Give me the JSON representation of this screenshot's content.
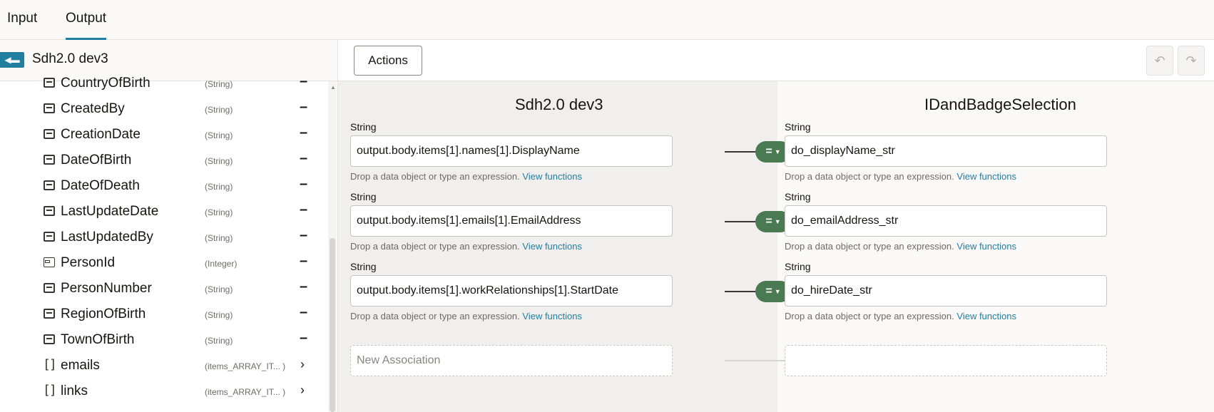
{
  "tabs": [
    {
      "label": "Input"
    },
    {
      "label": "Output"
    }
  ],
  "left_panel": {
    "back_icon": "back-arrow-icon",
    "title": "Sdh2.0 dev3",
    "fields": [
      {
        "name": "CountryOfBirth",
        "type": "(String)",
        "action": "–",
        "icon": "string-field-icon"
      },
      {
        "name": "CreatedBy",
        "type": "(String)",
        "action": "–",
        "icon": "string-field-icon"
      },
      {
        "name": "CreationDate",
        "type": "(String)",
        "action": "–",
        "icon": "string-field-icon"
      },
      {
        "name": "DateOfBirth",
        "type": "(String)",
        "action": "–",
        "icon": "string-field-icon"
      },
      {
        "name": "DateOfDeath",
        "type": "(String)",
        "action": "–",
        "icon": "string-field-icon"
      },
      {
        "name": "LastUpdateDate",
        "type": "(String)",
        "action": "–",
        "icon": "string-field-icon"
      },
      {
        "name": "LastUpdatedBy",
        "type": "(String)",
        "action": "–",
        "icon": "string-field-icon"
      },
      {
        "name": "PersonId",
        "type": "(Integer)",
        "action": "–",
        "icon": "integer-field-icon"
      },
      {
        "name": "PersonNumber",
        "type": "(String)",
        "action": "–",
        "icon": "string-field-icon"
      },
      {
        "name": "RegionOfBirth",
        "type": "(String)",
        "action": "–",
        "icon": "string-field-icon"
      },
      {
        "name": "TownOfBirth",
        "type": "(String)",
        "action": "–",
        "icon": "string-field-icon"
      },
      {
        "name": "emails",
        "type": "(items_ARRAY_IT... )",
        "action": "›",
        "icon": "array-field-icon"
      },
      {
        "name": "links",
        "type": "(items_ARRAY_IT... )",
        "action": "›",
        "icon": "array-field-icon"
      }
    ]
  },
  "toolbar": {
    "actions_label": "Actions",
    "undo_icon": "undo-icon",
    "redo_icon": "redo-icon"
  },
  "source": {
    "title": "Sdh2.0 dev3"
  },
  "target": {
    "title": "IDandBadgeSelection"
  },
  "mappings": [
    {
      "source_type": "String",
      "source_expr": "output.body.items[1].names[1].DisplayName",
      "source_hint": "Drop a data object or type an expression.",
      "source_link": "View functions",
      "operator": "=",
      "target_type": "String",
      "target_expr": "do_displayName_str",
      "target_hint": "Drop a data object or type an expression.",
      "target_link": "View functions"
    },
    {
      "source_type": "String",
      "source_expr": "output.body.items[1].emails[1].EmailAddress",
      "source_hint": "Drop a data object or type an expression.",
      "source_link": "View functions",
      "operator": "=",
      "target_type": "String",
      "target_expr": "do_emailAddress_str",
      "target_hint": "Drop a data object or type an expression.",
      "target_link": "View functions"
    },
    {
      "source_type": "String",
      "source_expr": "output.body.items[1].workRelationships[1].StartDate",
      "source_hint": "Drop a data object or type an expression.",
      "source_link": "View functions",
      "operator": "=",
      "target_type": "String",
      "target_expr": "do_hireDate_str",
      "target_hint": "Drop a data object or type an expression.",
      "target_link": "View functions"
    }
  ],
  "new_association": {
    "placeholder": "New Association",
    "target_value": ""
  }
}
